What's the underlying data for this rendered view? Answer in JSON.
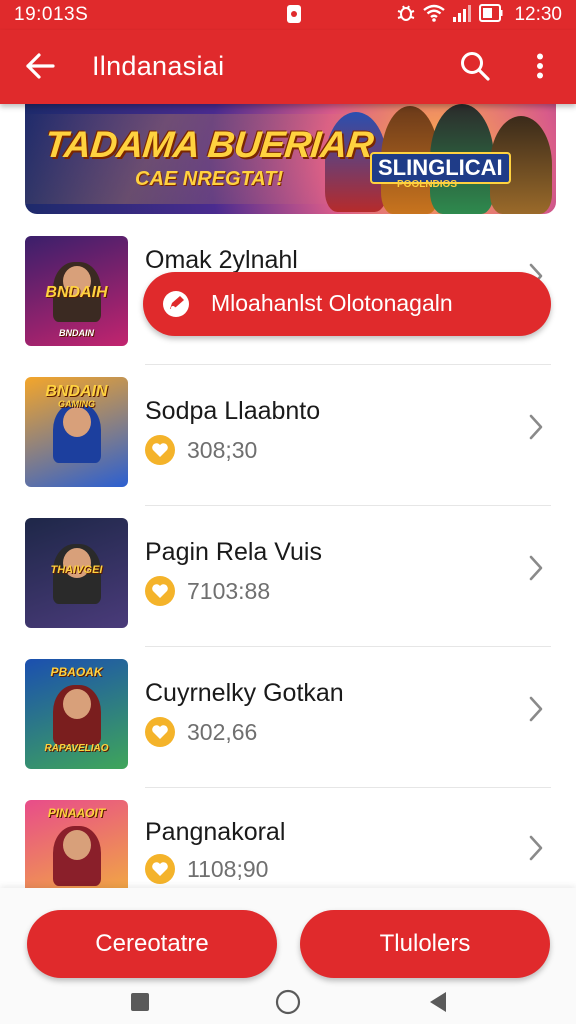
{
  "status_bar": {
    "time_left": "19:013S",
    "time_right": "12:30"
  },
  "app_bar": {
    "title": "Ilndanasiai",
    "back_icon": "arrow-left-icon",
    "search_icon": "search-icon",
    "more_icon": "more-vertical-icon"
  },
  "banner": {
    "headline": "TADAMA BUERIAR",
    "subline": "CAE NREGTAT!",
    "logo_text": "SLINGLICAI",
    "logo_sub": "POOLNDIOS"
  },
  "toast": {
    "icon": "pen-badge-icon",
    "text": "Mloahanlst Olotonagaln"
  },
  "list": {
    "items": [
      {
        "title": "Omak 2ylnahl",
        "thumb_text_top": "BNDAIH",
        "thumb_text_bottom": "BNDAIN",
        "thumb_colors": [
          "#3a1f6b",
          "#c2246e"
        ]
      },
      {
        "title": "Sodpa Llaabnto",
        "value": "308;30",
        "thumb_text_top": "BNDAIN",
        "thumb_text_bottom": "GAMING",
        "thumb_colors": [
          "#f4a62a",
          "#2b5fd1"
        ]
      },
      {
        "title": "Pagin Rela Vuis",
        "value": "7103:88",
        "thumb_text_top": "",
        "thumb_text_bottom": "THAIVGEI",
        "thumb_colors": [
          "#1e2748",
          "#4a3b7a"
        ]
      },
      {
        "title": "Cuyrnelky Gotkan",
        "value": "302,66",
        "thumb_text_top": "PBAOAK",
        "thumb_text_bottom": "RAPAVELIAO",
        "thumb_colors": [
          "#1b4fb0",
          "#3fa65a"
        ]
      },
      {
        "title": "Pangnakoral",
        "value": "1108;90",
        "thumb_text_top": "PINAAOIT",
        "thumb_text_bottom": "",
        "thumb_colors": [
          "#e84c8a",
          "#f2b43a"
        ]
      }
    ]
  },
  "bottom": {
    "left_button": "Cereotatre",
    "right_button": "Tlulolers"
  },
  "colors": {
    "primary": "#e02a2c",
    "coin": "#f4b32a",
    "value_text": "#6f6f6f"
  }
}
